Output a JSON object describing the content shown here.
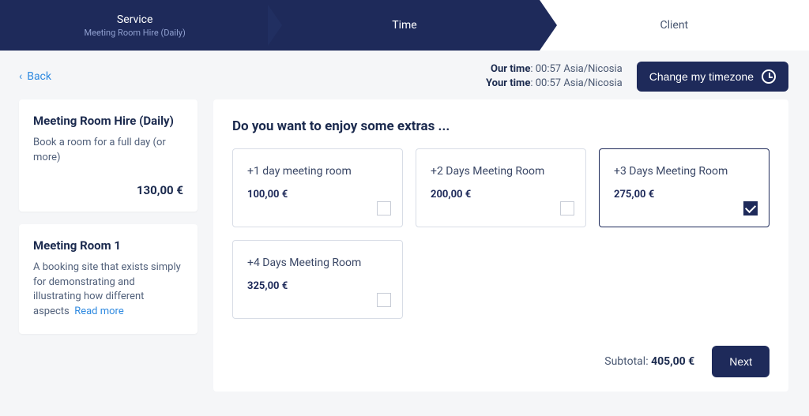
{
  "progress": {
    "steps": [
      {
        "label": "Service",
        "sub": "Meeting Room Hire (Daily)",
        "state": "done"
      },
      {
        "label": "Time",
        "state": "active"
      },
      {
        "label": "Client",
        "state": "upcoming"
      }
    ]
  },
  "back_label": "Back",
  "time": {
    "our_label": "Our time",
    "our_value": "00:57 Asia/Nicosia",
    "your_label": "Your time",
    "your_value": "00:57 Asia/Nicosia"
  },
  "timezone_button": "Change my timezone",
  "sidebar": {
    "cards": [
      {
        "title": "Meeting Room Hire (Daily)",
        "desc": "Book a room for a full day (or more)",
        "price": "130,00 €"
      },
      {
        "title": "Meeting Room 1",
        "desc": "A booking site that exists simply for demonstrating and illustrating how different aspects",
        "readmore": "Read more"
      }
    ]
  },
  "extras_heading": "Do you want to enjoy some extras ...",
  "extras": [
    {
      "name": "+1 day meeting room",
      "price": "100,00 €",
      "selected": false
    },
    {
      "name": "+2 Days Meeting Room",
      "price": "200,00 €",
      "selected": false
    },
    {
      "name": "+3 Days Meeting Room",
      "price": "275,00 €",
      "selected": true
    },
    {
      "name": "+4 Days Meeting Room",
      "price": "325,00 €",
      "selected": false
    }
  ],
  "subtotal_label": "Subtotal:",
  "subtotal_value": "405,00 €",
  "next_label": "Next"
}
